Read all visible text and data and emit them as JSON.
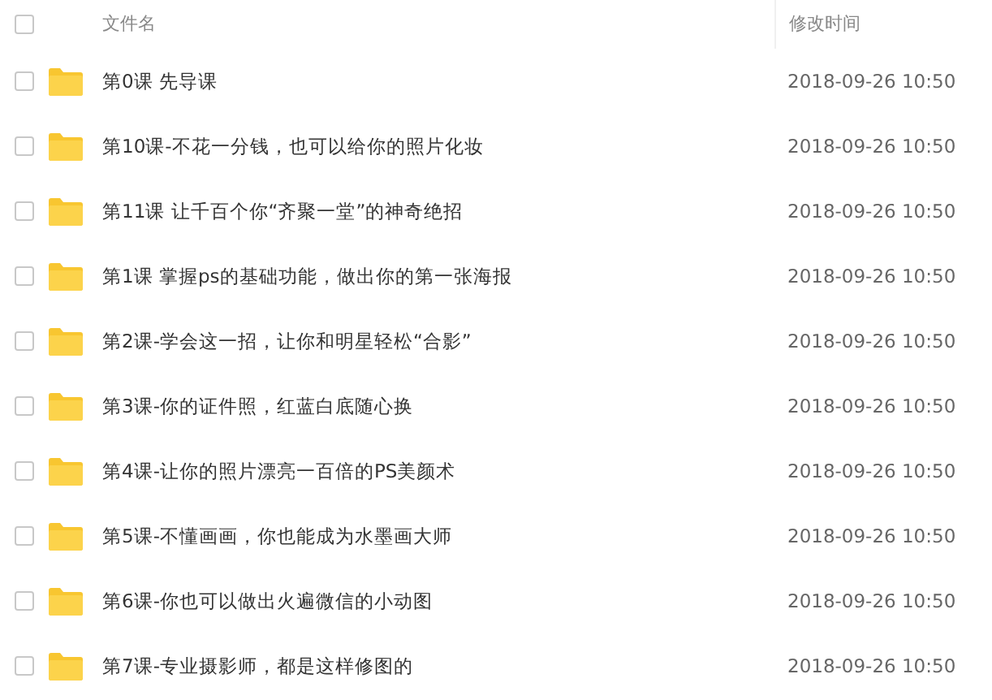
{
  "header": {
    "checked": false,
    "columns": [
      "文件名",
      "修改时间"
    ]
  },
  "rows": [
    {
      "name": "第0课 先导课",
      "modified": "2018-09-26 10:50",
      "checked": false
    },
    {
      "name": "第10课-不花一分钱，也可以给你的照片化妆",
      "modified": "2018-09-26 10:50",
      "checked": false
    },
    {
      "name": "第11课 让千百个你“齐聚一堂”的神奇绝招",
      "modified": "2018-09-26 10:50",
      "checked": false
    },
    {
      "name": "第1课 掌握ps的基础功能，做出你的第一张海报",
      "modified": "2018-09-26 10:50",
      "checked": false
    },
    {
      "name": "第2课-学会这一招，让你和明星轻松“合影”",
      "modified": "2018-09-26 10:50",
      "checked": false
    },
    {
      "name": "第3课-你的证件照，红蓝白底随心换",
      "modified": "2018-09-26 10:50",
      "checked": false
    },
    {
      "name": "第4课-让你的照片漂亮一百倍的PS美颜术",
      "modified": "2018-09-26 10:50",
      "checked": false
    },
    {
      "name": "第5课-不懂画画，你也能成为水墨画大师",
      "modified": "2018-09-26 10:50",
      "checked": false
    },
    {
      "name": "第6课-你也可以做出火遍微信的小动图",
      "modified": "2018-09-26 10:50",
      "checked": false
    },
    {
      "name": "第7课-专业摄影师，都是这样修图的",
      "modified": "2018-09-26 10:50",
      "checked": false
    }
  ]
}
